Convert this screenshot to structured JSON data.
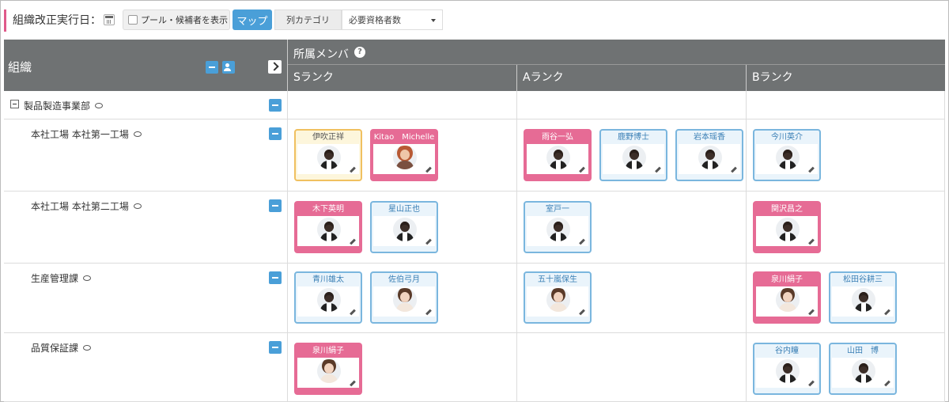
{
  "toolbar": {
    "date_label": "組織改正実行日：",
    "pool_label": "プール・候補者を表示",
    "map_label": "マップ",
    "col_category_label": "列カテゴリ",
    "col_select_value": "必要資格者数"
  },
  "grid": {
    "org_header": "組織",
    "members_header": "所属メンバ",
    "help_glyph": "?",
    "ranks": [
      "Sランク",
      "Aランク",
      "Bランク"
    ]
  },
  "rows": [
    {
      "name": "製品製造事業部",
      "S": [],
      "A": [],
      "B": []
    },
    {
      "name": "本社工場 本社第一工場",
      "S": [
        {
          "name": "伊吹正祥",
          "style": "yellow",
          "avatar": "m"
        },
        {
          "name": "Kitao　Michelle",
          "style": "pink",
          "avatar": "w"
        }
      ],
      "A": [
        {
          "name": "雨谷一弘",
          "style": "pink",
          "avatar": "m"
        },
        {
          "name": "鹿野博士",
          "style": "blue",
          "avatar": "m"
        },
        {
          "name": "岩本瑶香",
          "style": "blue",
          "avatar": "m"
        }
      ],
      "B": [
        {
          "name": "今川英介",
          "style": "blue",
          "avatar": "m"
        }
      ]
    },
    {
      "name": "本社工場 本社第二工場",
      "S": [
        {
          "name": "木下英明",
          "style": "pink",
          "avatar": "m"
        },
        {
          "name": "星山正也",
          "style": "blue",
          "avatar": "m"
        }
      ],
      "A": [
        {
          "name": "室戸一",
          "style": "blue",
          "avatar": "m"
        }
      ],
      "B": [
        {
          "name": "関沢昌之",
          "style": "pink",
          "avatar": "m"
        }
      ]
    },
    {
      "name": "生産管理課",
      "S": [
        {
          "name": "青川雄太",
          "style": "blue",
          "avatar": "m"
        },
        {
          "name": "佐伯弓月",
          "style": "blue",
          "avatar": "f"
        }
      ],
      "A": [
        {
          "name": "五十嵐保生",
          "style": "blue",
          "avatar": "f"
        }
      ],
      "B": [
        {
          "name": "泉川絹子",
          "style": "pink",
          "avatar": "f"
        },
        {
          "name": "松田谷耕三",
          "style": "blue",
          "avatar": "m"
        }
      ]
    },
    {
      "name": "品質保証課",
      "S": [
        {
          "name": "泉川絹子",
          "style": "pink",
          "avatar": "f"
        }
      ],
      "A": [],
      "B": [
        {
          "name": "谷内瞳",
          "style": "blue",
          "avatar": "m"
        },
        {
          "name": "山田　博",
          "style": "blue",
          "avatar": "m"
        }
      ]
    }
  ]
}
